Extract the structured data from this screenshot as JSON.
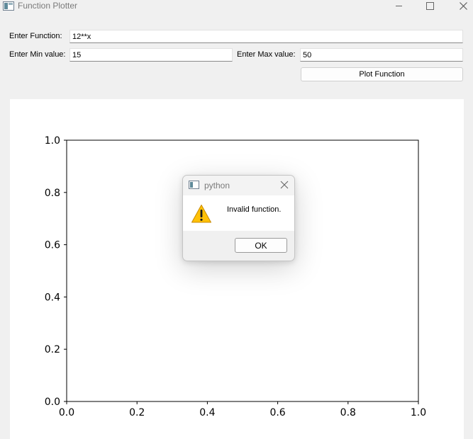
{
  "window": {
    "title": "Function Plotter"
  },
  "form": {
    "function_label": "Enter Function:",
    "function_value": "12**x",
    "min_label": "Enter Min value:",
    "min_value": "15",
    "max_label": "Enter Max value:",
    "max_value": "50",
    "plot_button_label": "Plot Function"
  },
  "chart_data": {
    "type": "line",
    "series": [],
    "xlim": [
      0.0,
      1.0
    ],
    "ylim": [
      0.0,
      1.0
    ],
    "xticks": [
      "0.0",
      "0.2",
      "0.4",
      "0.6",
      "0.8",
      "1.0"
    ],
    "yticks": [
      "0.0",
      "0.2",
      "0.4",
      "0.6",
      "0.8",
      "1.0"
    ],
    "grid": false
  },
  "dialog": {
    "title": "python",
    "message": "Invalid function.",
    "ok_label": "OK",
    "icon": "warning-icon",
    "warning_color": "#ffc107"
  }
}
